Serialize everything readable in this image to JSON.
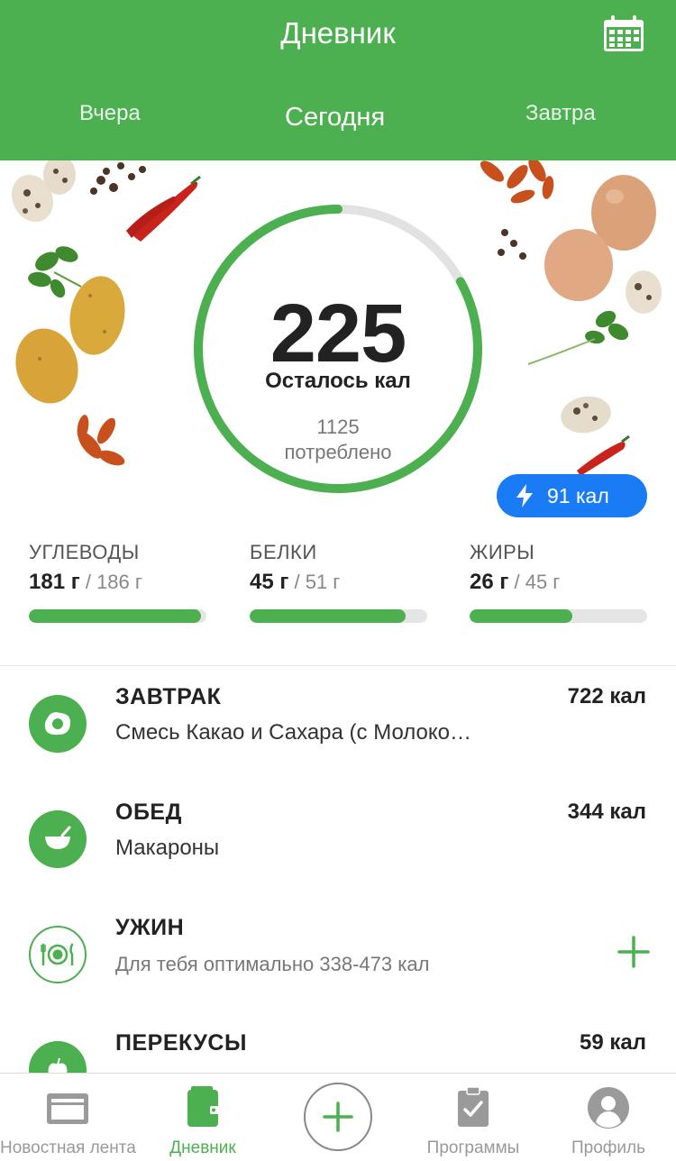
{
  "header": {
    "title": "Дневник",
    "tabs": [
      {
        "label": "Вчера"
      },
      {
        "label": "Сегодня"
      },
      {
        "label": "Завтра"
      }
    ],
    "active_tab": "Сегодня",
    "calendar_icon": "calendar-icon"
  },
  "summary": {
    "remaining": "225",
    "remaining_label": "Осталось кал",
    "consumed": "1125",
    "consumed_label": "потреблено",
    "progress_fraction": 0.83,
    "burned_badge": "91 кал",
    "burned_icon": "lightning-icon"
  },
  "macros": [
    {
      "name": "УГЛЕВОДЫ",
      "current": "181 г",
      "goal": "/ 186 г",
      "fraction": 0.97
    },
    {
      "name": "БЕЛКИ",
      "current": "45 г",
      "goal": "/ 51 г",
      "fraction": 0.88
    },
    {
      "name": "ЖИРЫ",
      "current": "26 г",
      "goal": "/ 45 г",
      "fraction": 0.58
    }
  ],
  "meals": [
    {
      "title": "ЗАВТРАК",
      "subtitle": "Смесь Какао и Сахара (с Молоко…",
      "kcal": "722 кал",
      "icon": "egg-icon"
    },
    {
      "title": "ОБЕД",
      "subtitle": "Макароны",
      "kcal": "344 кал",
      "icon": "bowl-icon"
    },
    {
      "title": "УЖИН",
      "subtitle": "Для тебя оптимально 338-473 кал",
      "kcal": "",
      "icon": "plate-cutlery-icon"
    },
    {
      "title": "ПЕРЕКУСЫ",
      "subtitle": "",
      "kcal": "59 кал",
      "icon": "apple-icon"
    }
  ],
  "bottom_nav": [
    {
      "label": "Новостная лента",
      "icon": "newsfeed-icon"
    },
    {
      "label": "Дневник",
      "icon": "diary-icon",
      "active": true
    },
    {
      "label": "",
      "icon": "add-icon"
    },
    {
      "label": "Программы",
      "icon": "clipboard-check-icon"
    },
    {
      "label": "Профиль",
      "icon": "profile-icon"
    }
  ],
  "colors": {
    "brand_green": "#4caf50",
    "badge_blue": "#1a7cf5",
    "track_gray": "#e5e5e5"
  }
}
